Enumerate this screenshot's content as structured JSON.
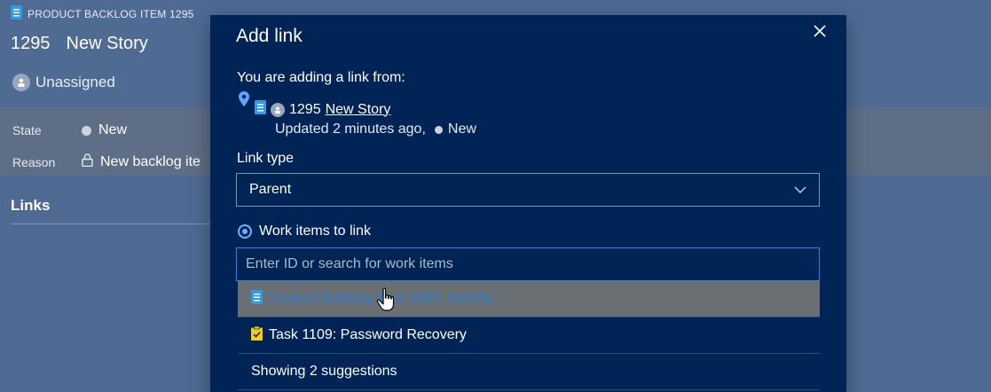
{
  "work_item": {
    "type_label": "PRODUCT BACKLOG ITEM 1295",
    "id": "1295",
    "title": "New Story",
    "assigned": "Unassigned",
    "fields": {
      "state_label": "State",
      "state_value": "New",
      "reason_label": "Reason",
      "reason_value": "New backlog ite"
    },
    "links_heading": "Links"
  },
  "dialog": {
    "title": "Add link",
    "adding_from_label": "You are adding a link from:",
    "source_id": "1295",
    "source_title": "New Story",
    "source_updated": "Updated 2 minutes ago,",
    "source_state": "New",
    "link_type_label": "Link type",
    "link_type_value": "Parent",
    "work_items_label": "Work items to link",
    "search_placeholder": "Enter ID or search for work items",
    "suggestions": [
      {
        "label": "Product Backlog Item 1093: Identity",
        "icon": "backlog-item-icon"
      },
      {
        "label": "Task 1109: Password Recovery",
        "icon": "task-icon"
      }
    ],
    "suggestions_footer": "Showing 2 suggestions"
  },
  "colors": {
    "dialog_bg": "#012456",
    "accent": "#3d7fd6",
    "hover_bg": "#6a6f74",
    "hover_text": "#2b7fcf"
  }
}
